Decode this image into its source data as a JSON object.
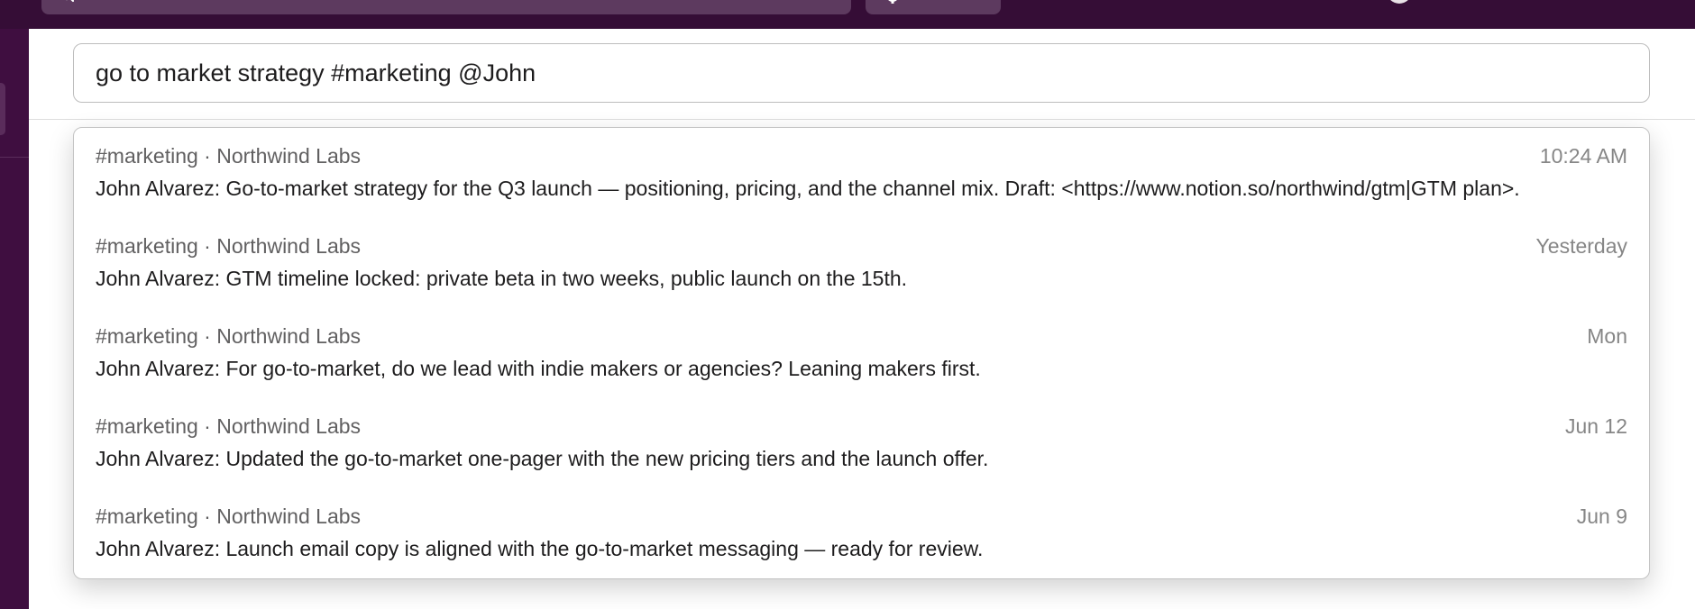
{
  "search": {
    "query": "go to market strategy #marketing @John"
  },
  "results": [
    {
      "meta": "#marketing · Northwind Labs",
      "time": "10:24 AM",
      "text": "John Alvarez: Go-to-market strategy for the Q3 launch — positioning, pricing, and the channel mix. Draft: <https://www.notion.so/northwind/gtm|GTM plan>."
    },
    {
      "meta": "#marketing · Northwind Labs",
      "time": "Yesterday",
      "text": "John Alvarez: GTM timeline locked: private beta in two weeks, public launch on the 15th."
    },
    {
      "meta": "#marketing · Northwind Labs",
      "time": "Mon",
      "text": "John Alvarez: For go-to-market, do we lead with indie makers or agencies? Leaning makers first."
    },
    {
      "meta": "#marketing · Northwind Labs",
      "time": "Jun 12",
      "text": "John Alvarez: Updated the go-to-market one-pager with the new pricing tiers and the launch offer."
    },
    {
      "meta": "#marketing · Northwind Labs",
      "time": "Jun 9",
      "text": "John Alvarez: Launch email copy is aligned with the go-to-market messaging — ready for review."
    }
  ],
  "icons": {
    "top_search": "search-icon",
    "help": "help-icon",
    "avatar": "user-avatar"
  },
  "colors": {
    "topbar": "#350d36",
    "sidebar": "#3f0e40",
    "accent_pill": "#5d3a5f"
  }
}
